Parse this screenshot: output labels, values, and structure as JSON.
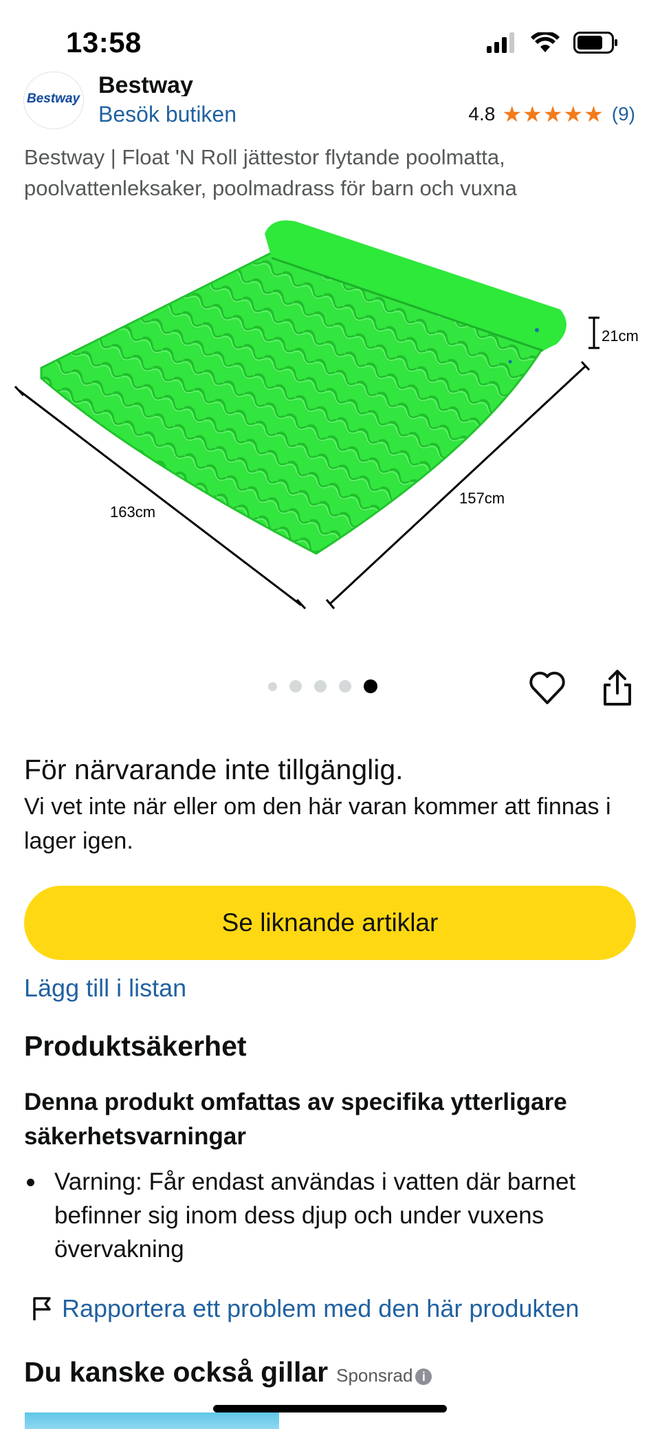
{
  "status_bar": {
    "time": "13:58"
  },
  "brand": {
    "name": "Bestway",
    "logo_text": "Bestway",
    "visit_store": "Besök butiken",
    "rating_value": "4.8",
    "rating_stars": 4.8,
    "rating_count": "(9)"
  },
  "product": {
    "title": "Bestway | Float 'N Roll jättestor flytande poolmatta, poolvattenleksaker, poolmadrass för barn och vuxna",
    "dimension_width": "163cm",
    "dimension_depth": "157cm",
    "dimension_height": "21cm",
    "mattress_color": "#2ee83a"
  },
  "carousel": {
    "count": 5,
    "active_index": 4
  },
  "availability": {
    "status": "För närvarande inte tillgänglig.",
    "note": "Vi vet inte när eller om den här varan kommer att finnas i lager igen."
  },
  "actions": {
    "see_similar": "Se liknande artiklar",
    "add_to_list": "Lägg till i listan"
  },
  "safety": {
    "heading": "Produktsäkerhet",
    "subheading": "Denna produkt omfattas av specifika ytterligare säkerhetsvarningar",
    "warnings": [
      "Varning: Får endast användas i vatten där barnet befinner sig inom dess djup och under vuxens övervakning"
    ],
    "report_link": "Rapportera ett problem med den här produkten"
  },
  "recommendations": {
    "heading": "Du kanske också gillar",
    "sponsored": "Sponsrad",
    "info_icon": "i"
  },
  "colors": {
    "link": "#2162a1",
    "cta": "#ffd814",
    "star": "#f27b1c",
    "text": "#0f1111",
    "muted": "#565959"
  }
}
